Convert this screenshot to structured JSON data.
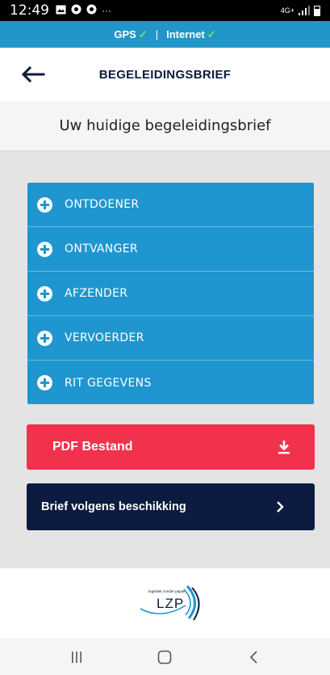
{
  "status_bar": {
    "time": "12:49",
    "icons": [
      "image-icon",
      "chrome-icon",
      "chrome-icon",
      "more-icon"
    ],
    "more": "···",
    "network": "4G+"
  },
  "connection": {
    "gps_label": "GPS",
    "separator": "|",
    "internet_label": "Internet",
    "check": "✓",
    "status_color": "#7be36b"
  },
  "header": {
    "title": "BEGELEIDINGSBRIEF",
    "back_icon": "arrow-left-icon"
  },
  "subtitle": "Uw huidige begeleidingsbrief",
  "accordion": {
    "items": [
      {
        "label": "ONTDOENER"
      },
      {
        "label": "ONTVANGER"
      },
      {
        "label": "AFZENDER"
      },
      {
        "label": "VERVOERDER"
      },
      {
        "label": "RIT GEGEVENS"
      }
    ],
    "color": "#1f96cf"
  },
  "buttons": {
    "pdf_label": "PDF Bestand",
    "pdf_color": "#f2314c",
    "pdf_icon": "download-icon",
    "brief_label": "Brief volgens beschikking",
    "brief_color": "#0c1b3f",
    "brief_icon": "chevron-right-icon"
  },
  "footer": {
    "logo_tagline": "logistiek zonder papier",
    "logo_text": "LZP"
  },
  "nav": {
    "recent_icon": "recent-apps-icon",
    "home_icon": "home-icon",
    "back_icon": "back-icon"
  }
}
